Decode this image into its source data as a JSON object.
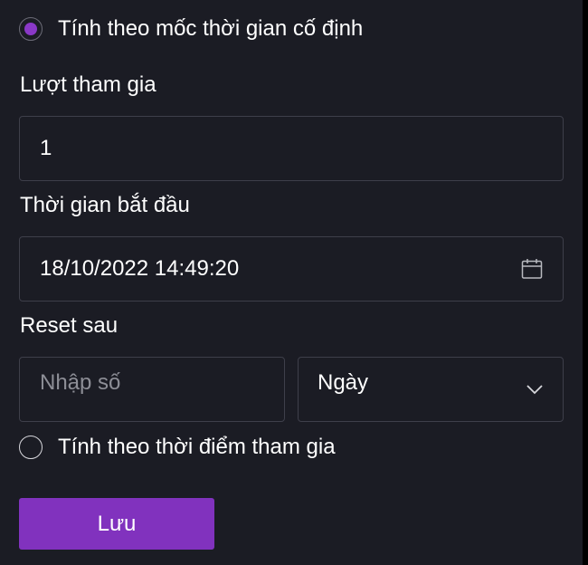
{
  "options": {
    "fixed_time": {
      "label": "Tính theo mốc thời gian cố định",
      "selected": true
    },
    "join_time": {
      "label": "Tính theo thời điểm tham gia",
      "selected": false
    }
  },
  "participation": {
    "label": "Lượt tham gia",
    "value": "1"
  },
  "start_time": {
    "label": "Thời gian bắt đầu",
    "value": "18/10/2022 14:49:20",
    "icon": "calendar-icon"
  },
  "reset": {
    "label": "Reset sau",
    "number_placeholder": "Nhập số",
    "unit_selected": "Ngày",
    "unit_icon": "chevron-down-icon"
  },
  "actions": {
    "save_label": "Lưu"
  },
  "colors": {
    "background": "#1b1c24",
    "accent": "#8132be",
    "border": "#3e3f4a",
    "placeholder": "#8d8e96"
  }
}
